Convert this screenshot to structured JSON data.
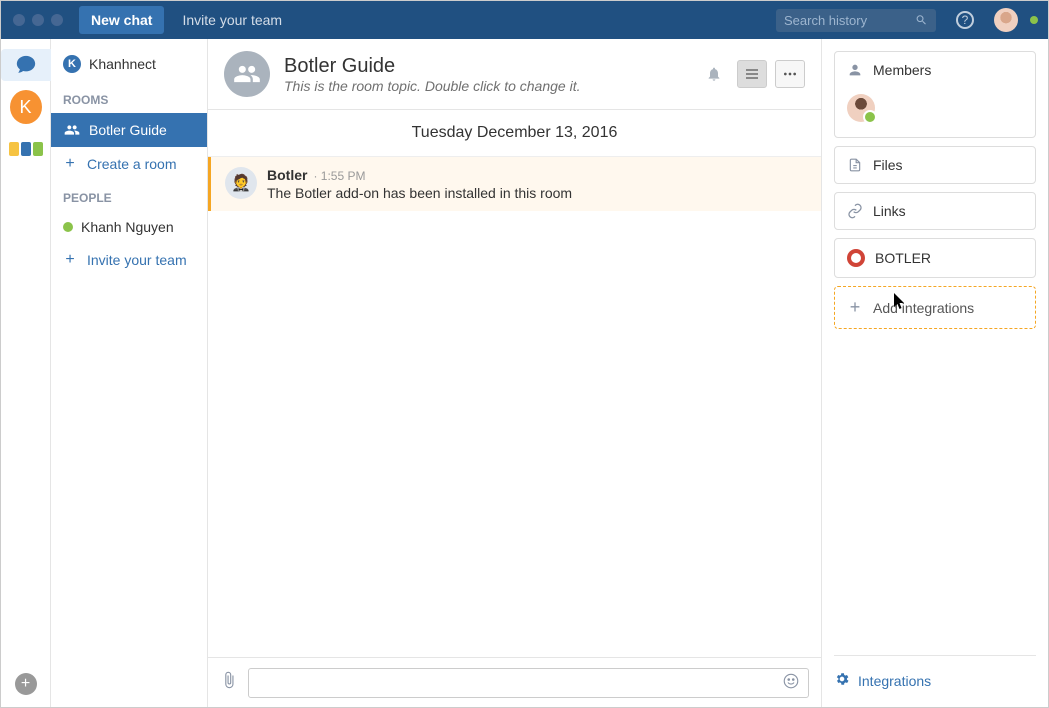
{
  "topbar": {
    "new_chat": "New chat",
    "invite": "Invite your team",
    "search_placeholder": "Search history"
  },
  "sidebar": {
    "workspace": "Khanhnect",
    "rooms_header": "ROOMS",
    "rooms": [
      {
        "label": "Botler Guide"
      }
    ],
    "create_room": "Create a room",
    "people_header": "PEOPLE",
    "people": [
      {
        "label": "Khanh Nguyen"
      }
    ],
    "invite_team": "Invite your team"
  },
  "chat": {
    "title": "Botler Guide",
    "topic": "This is the room topic. Double click to change it.",
    "date": "Tuesday December 13, 2016",
    "messages": [
      {
        "sender": "Botler",
        "time": "1:55 PM",
        "body": "The Botler add-on has been installed in this room"
      }
    ]
  },
  "rpanel": {
    "members": "Members",
    "files": "Files",
    "links": "Links",
    "botler": "BOTLER",
    "add_integrations": "Add integrations",
    "integrations": "Integrations"
  }
}
